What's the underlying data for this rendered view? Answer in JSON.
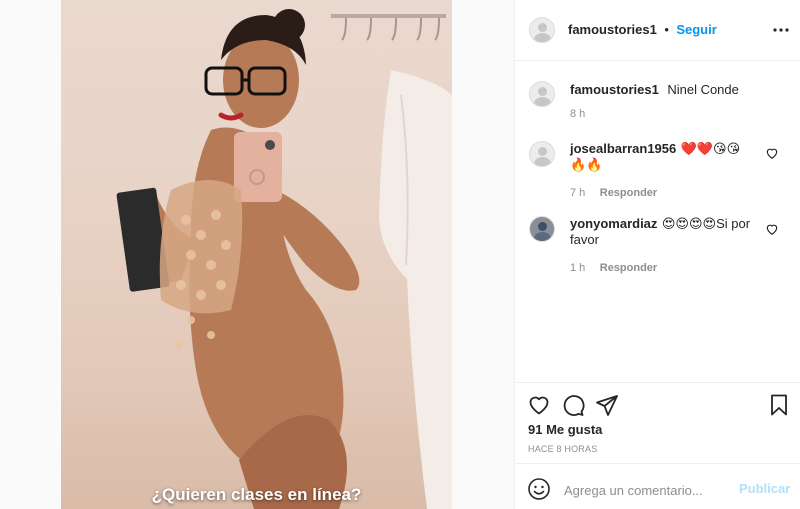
{
  "post": {
    "image_overlay_text": "¿Quieren clases en línea?"
  },
  "header": {
    "username": "famoustories1",
    "separator": "•",
    "follow_label": "Seguir",
    "more_icon": "more-horizontal-icon"
  },
  "caption": {
    "username": "famoustories1",
    "text": "Ninel Conde",
    "time": "8 h"
  },
  "comments": [
    {
      "username": "josealbarran1956",
      "text_line1": "❤️❤️😘😘",
      "text_line2": "🔥🔥",
      "time": "7 h",
      "reply_label": "Responder"
    },
    {
      "username": "yonyomardiaz",
      "text_line1": "😍😍😍😍Si por",
      "text_line2": "favor",
      "time": "1 h",
      "reply_label": "Responder"
    }
  ],
  "actions": {
    "likes": "91 Me gusta",
    "time_ago": "HACE 8 HORAS"
  },
  "comment_box": {
    "placeholder": "Agrega un comentario...",
    "publish_label": "Publicar"
  },
  "colors": {
    "accent": "#0095f6",
    "publish_disabled": "#b2dffc",
    "muted": "#8e8e8e"
  }
}
